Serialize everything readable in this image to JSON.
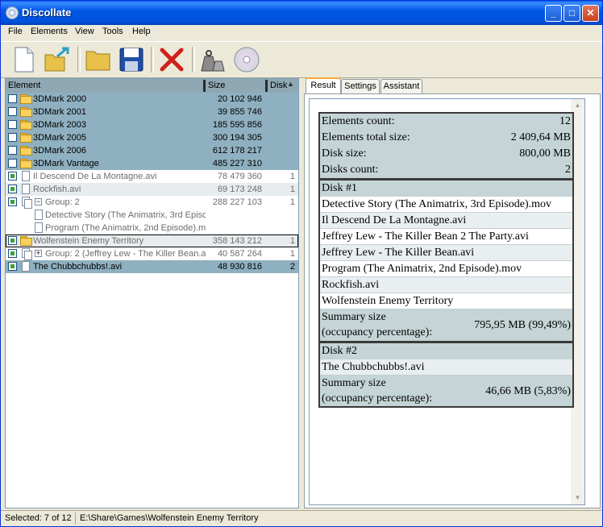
{
  "window": {
    "title": "Discollate"
  },
  "menu": [
    "File",
    "Elements",
    "View",
    "Tools",
    "Help"
  ],
  "list": {
    "columns": {
      "element": "Element",
      "size": "Size",
      "disk": "Disk"
    },
    "rows": [
      {
        "name": "3DMark 2000",
        "size": "20 102 946",
        "disk": ""
      },
      {
        "name": "3DMark 2001",
        "size": "39 855 746",
        "disk": ""
      },
      {
        "name": "3DMark 2003",
        "size": "185 595 856",
        "disk": ""
      },
      {
        "name": "3DMark 2005",
        "size": "300 194 305",
        "disk": ""
      },
      {
        "name": "3DMark 2006",
        "size": "612 178 217",
        "disk": ""
      },
      {
        "name": "3DMark Vantage",
        "size": "485 227 310",
        "disk": ""
      },
      {
        "name": "Il Descend De La Montagne.avi",
        "size": "78 479 360",
        "disk": "1"
      },
      {
        "name": "Rockfish.avi",
        "size": "69 173 248",
        "disk": "1"
      },
      {
        "name": "Group: 2",
        "size": "288 227 103",
        "disk": "1"
      },
      {
        "name": "Detective Story (The Animatrix, 3rd Episc",
        "size": "",
        "disk": ""
      },
      {
        "name": "Program (The Animatrix, 2nd Episode).mc",
        "size": "",
        "disk": ""
      },
      {
        "name": "Wolfenstein Enemy Territory",
        "size": "358 143 212",
        "disk": "1"
      },
      {
        "name": "Group: 2 (Jeffrey Lew - The Killer Bean.a",
        "size": "40 587 264",
        "disk": "1"
      },
      {
        "name": "The Chubbchubbs!.avi",
        "size": "48 930 816",
        "disk": "2"
      }
    ]
  },
  "tabs": [
    "Result",
    "Settings",
    "Assistant"
  ],
  "report": {
    "summary": [
      {
        "label": "Elements count:",
        "value": "12"
      },
      {
        "label": "Elements total size:",
        "value": "2 409,64 MB"
      },
      {
        "label": "Disk size:",
        "value": "800,00 MB"
      },
      {
        "label": "Disks count:",
        "value": "2"
      }
    ],
    "disk1": {
      "title": "Disk #1",
      "items": [
        "Detective Story (The Animatrix, 3rd Episode).mov",
        "Il Descend De La Montagne.avi",
        "Jeffrey Lew - The Killer Bean 2 The Party.avi",
        "Jeffrey Lew - The Killer Bean.avi",
        "Program (The Animatrix, 2nd Episode).mov",
        "Rockfish.avi",
        "Wolfenstein Enemy Territory"
      ],
      "summary_label_1": "Summary size",
      "summary_label_2": "(occupancy percentage):",
      "summary_value": "795,95 MB (99,49%)"
    },
    "disk2": {
      "title": "Disk #2",
      "items": [
        "The Chubbchubbs!.avi"
      ],
      "summary_label_1": "Summary size",
      "summary_label_2": "(occupancy percentage):",
      "summary_value": "46,66 MB (5,83%)"
    }
  },
  "status": {
    "selected": "Selected: 7 of 12",
    "path": "E:\\Share\\Games\\Wolfenstein Enemy Territory"
  }
}
